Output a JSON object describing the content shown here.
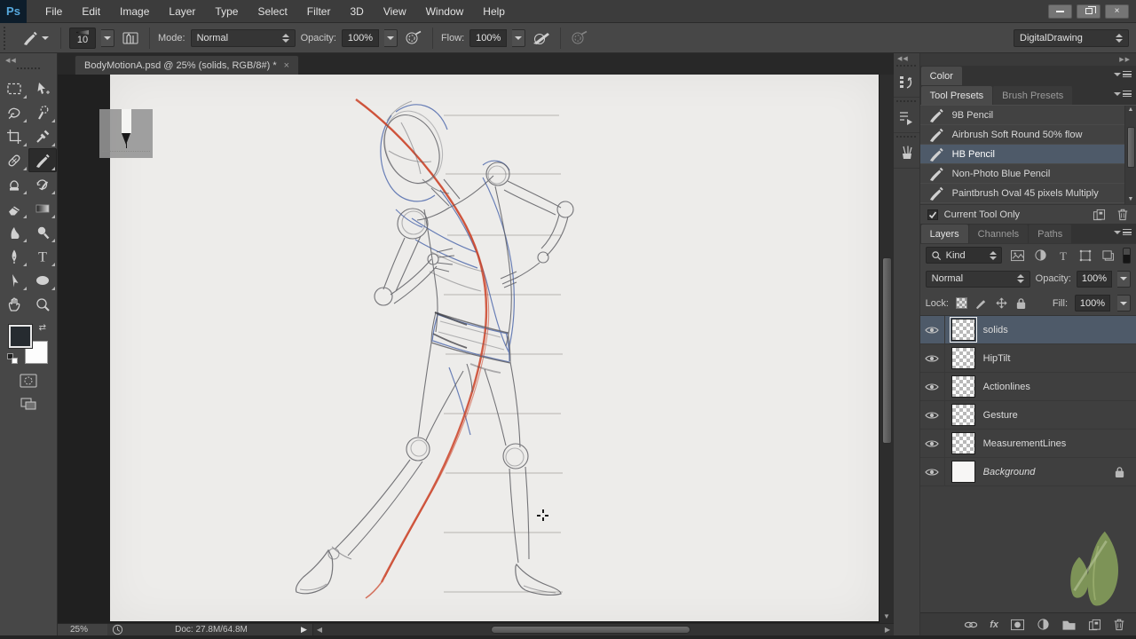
{
  "app": {
    "logo_text": "Ps"
  },
  "menu_bar": {
    "items": [
      "File",
      "Edit",
      "Image",
      "Layer",
      "Type",
      "Select",
      "Filter",
      "3D",
      "View",
      "Window",
      "Help"
    ]
  },
  "options_bar": {
    "brush_size": "10",
    "mode_label": "Mode:",
    "mode_value": "Normal",
    "opacity_label": "Opacity:",
    "opacity_value": "100%",
    "flow_label": "Flow:",
    "flow_value": "100%",
    "workspace": "DigitalDrawing"
  },
  "document": {
    "tab_title": "BodyMotionA.psd @ 25% (solids, RGB/8#) *",
    "close_glyph": "×"
  },
  "status_bar": {
    "zoom": "25%",
    "doc_info": "Doc: 27.8M/64.8M"
  },
  "toolbar": {
    "tools": [
      "rectangular-marquee",
      "move",
      "lasso",
      "quick-selection",
      "crop",
      "eyedropper",
      "spot-healing",
      "brush",
      "clone-stamp",
      "history-brush",
      "eraser",
      "gradient",
      "smudge",
      "dodge",
      "pen",
      "type",
      "path-selection",
      "ellipse-shape",
      "hand",
      "zoom"
    ],
    "selected_tool": "brush"
  },
  "dock_icons": [
    "history",
    "actions",
    "brush-panel"
  ],
  "panels": {
    "color_tab": "Color",
    "presets": {
      "tabs": [
        "Tool Presets",
        "Brush Presets"
      ],
      "active_tab": "Tool Presets",
      "items": [
        "9B Pencil",
        "Airbrush Soft Round 50% flow",
        "HB Pencil",
        "Non-Photo Blue Pencil",
        "Paintbrush Oval 45 pixels Multiply"
      ],
      "selected_item": "HB Pencil",
      "current_tool_only_label": "Current Tool Only"
    },
    "layers": {
      "tabs": [
        "Layers",
        "Channels",
        "Paths"
      ],
      "active_tab": "Layers",
      "filter_label": "Kind",
      "blend_mode": "Normal",
      "opacity_label": "Opacity:",
      "opacity_value": "100%",
      "lock_label": "Lock:",
      "fill_label": "Fill:",
      "fill_value": "100%",
      "fx_label": "fx",
      "items": [
        {
          "name": "solids",
          "selected": true
        },
        {
          "name": "HipTilt"
        },
        {
          "name": "Actionlines"
        },
        {
          "name": "Gesture"
        },
        {
          "name": "MeasurementLines"
        },
        {
          "name": "Background",
          "locked": true,
          "italic": true
        }
      ]
    }
  },
  "colors": {
    "action_line_red": "#cb4328",
    "construction_blue": "#3c5aa5",
    "pencil_gray": "#606065",
    "leaf_green": "#7d9357",
    "selection_highlight": "#4e5a69",
    "logo_blue": "#56a9de",
    "paper": "#edecea"
  }
}
